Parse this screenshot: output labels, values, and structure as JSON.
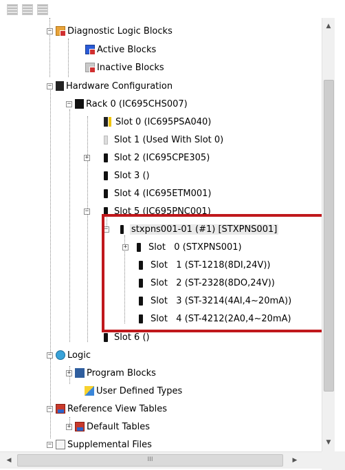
{
  "toolbar": {
    "icons": [
      "grid-view-icon",
      "image-view-icon",
      "list-view-icon"
    ]
  },
  "tree": {
    "diagnostic_logic_blocks": "Diagnostic Logic Blocks",
    "active_blocks": "Active Blocks",
    "inactive_blocks": "Inactive Blocks",
    "hardware_configuration": "Hardware Configuration",
    "rack0": "Rack 0 (IC695CHS007)",
    "slots": [
      "Slot 0 (IC695PSA040)",
      "Slot 1 (Used With Slot 0)",
      "Slot 2 (IC695CPE305)",
      "Slot 3 ()",
      "Slot 4 (IC695ETM001)",
      "Slot 5 (IC695PNC001)"
    ],
    "stxpns": "stxpns001-01 (#1) [STXPNS001]",
    "stx_slots": [
      "Slot   0 (STXPNS001)",
      "Slot   1 (ST-1218(8DI,24V))",
      "Slot   2 (ST-2328(8DO,24V))",
      "Slot   3 (ST-3214(4AI,4~20mA))",
      "Slot   4 (ST-4212(2A0,4~20mA)"
    ],
    "slot6": "Slot 6 ()",
    "logic": "Logic",
    "program_blocks": "Program Blocks",
    "user_defined_types": "User Defined Types",
    "reference_view_tables": "Reference View Tables",
    "default_tables": "Default Tables",
    "supplemental_files": "Supplemental Files"
  },
  "scroll": {
    "h_thumb_grip": "III"
  },
  "colors": {
    "highlight": "#c0181c"
  }
}
